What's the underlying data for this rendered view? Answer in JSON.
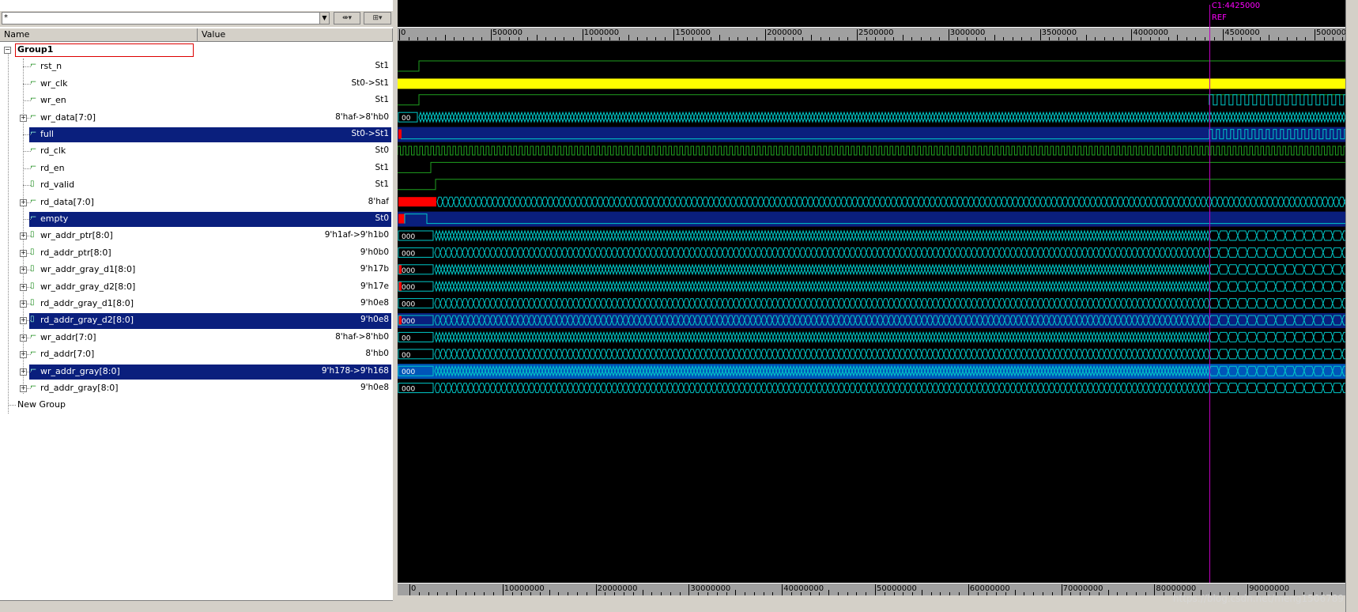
{
  "toolbar": {
    "filter_value": "*",
    "filter_drop": "▼",
    "btn1": "⇼▾",
    "btn2": "⊞▾"
  },
  "columns": {
    "name": "Name",
    "value": "Value"
  },
  "group": {
    "name": "Group1",
    "new_group": "New Group"
  },
  "signals": [
    {
      "name": "rst_n",
      "value": "St1",
      "icon": "wire",
      "expand": false,
      "hl": false
    },
    {
      "name": "wr_clk",
      "value": "St0->St1",
      "icon": "wire",
      "expand": false,
      "hl": false
    },
    {
      "name": "wr_en",
      "value": "St1",
      "icon": "wire",
      "expand": false,
      "hl": false
    },
    {
      "name": "wr_data[7:0]",
      "value": "8'haf->8'hb0",
      "icon": "wire",
      "expand": true,
      "hl": false
    },
    {
      "name": "full",
      "value": "St0->St1",
      "icon": "wire",
      "expand": false,
      "hl": true
    },
    {
      "name": "rd_clk",
      "value": "St0",
      "icon": "wire",
      "expand": false,
      "hl": false
    },
    {
      "name": "rd_en",
      "value": "St1",
      "icon": "wire",
      "expand": false,
      "hl": false
    },
    {
      "name": "rd_valid",
      "value": "St1",
      "icon": "reg",
      "expand": false,
      "hl": false
    },
    {
      "name": "rd_data[7:0]",
      "value": "8'haf",
      "icon": "wire",
      "expand": true,
      "hl": false
    },
    {
      "name": "empty",
      "value": "St0",
      "icon": "wire",
      "expand": false,
      "hl": true
    },
    {
      "name": "wr_addr_ptr[8:0]",
      "value": "9'h1af->9'h1b0",
      "icon": "reg",
      "expand": true,
      "hl": false
    },
    {
      "name": "rd_addr_ptr[8:0]",
      "value": "9'h0b0",
      "icon": "reg",
      "expand": true,
      "hl": false
    },
    {
      "name": "wr_addr_gray_d1[8:0]",
      "value": "9'h17b",
      "icon": "reg",
      "expand": true,
      "hl": false
    },
    {
      "name": "wr_addr_gray_d2[8:0]",
      "value": "9'h17e",
      "icon": "reg",
      "expand": true,
      "hl": false
    },
    {
      "name": "rd_addr_gray_d1[8:0]",
      "value": "9'h0e8",
      "icon": "reg",
      "expand": true,
      "hl": false
    },
    {
      "name": "rd_addr_gray_d2[8:0]",
      "value": "9'h0e8",
      "icon": "reg",
      "expand": true,
      "hl": true
    },
    {
      "name": "wr_addr[7:0]",
      "value": "8'haf->8'hb0",
      "icon": "wire",
      "expand": true,
      "hl": false
    },
    {
      "name": "rd_addr[7:0]",
      "value": "8'hb0",
      "icon": "wire",
      "expand": true,
      "hl": false
    },
    {
      "name": "wr_addr_gray[8:0]",
      "value": "9'h178->9'h168",
      "icon": "wire",
      "expand": true,
      "hl": true
    },
    {
      "name": "rd_addr_gray[8:0]",
      "value": "9'h0e8",
      "icon": "wire",
      "expand": true,
      "hl": false
    }
  ],
  "bus_labels": [
    "00",
    "00",
    "000",
    "000",
    "000",
    "000",
    "000",
    "000",
    "00",
    "00",
    "000",
    "000"
  ],
  "top_ruler": [
    "0",
    "500000",
    "1000000",
    "1500000",
    "2000000",
    "2500000",
    "3000000",
    "3500000",
    "4000000",
    "4500000",
    "5000000"
  ],
  "bottom_ruler": [
    "0",
    "10000000",
    "20000000",
    "30000000",
    "40000000",
    "50000000",
    "60000000",
    "70000000",
    "80000000",
    "90000000"
  ],
  "cursor": {
    "label": "C1:4425000",
    "ref": "REF",
    "time": 4425000
  },
  "colors": {
    "wire": "#1fa01f",
    "clock_fill": "#ffff00",
    "bus": "#00c8c8",
    "unknown": "#ff0000",
    "selected_bg": "#0a1f7d",
    "cursor": "#ff00ff"
  },
  "watermark": "https://blog.csdn.net/meng1506789"
}
